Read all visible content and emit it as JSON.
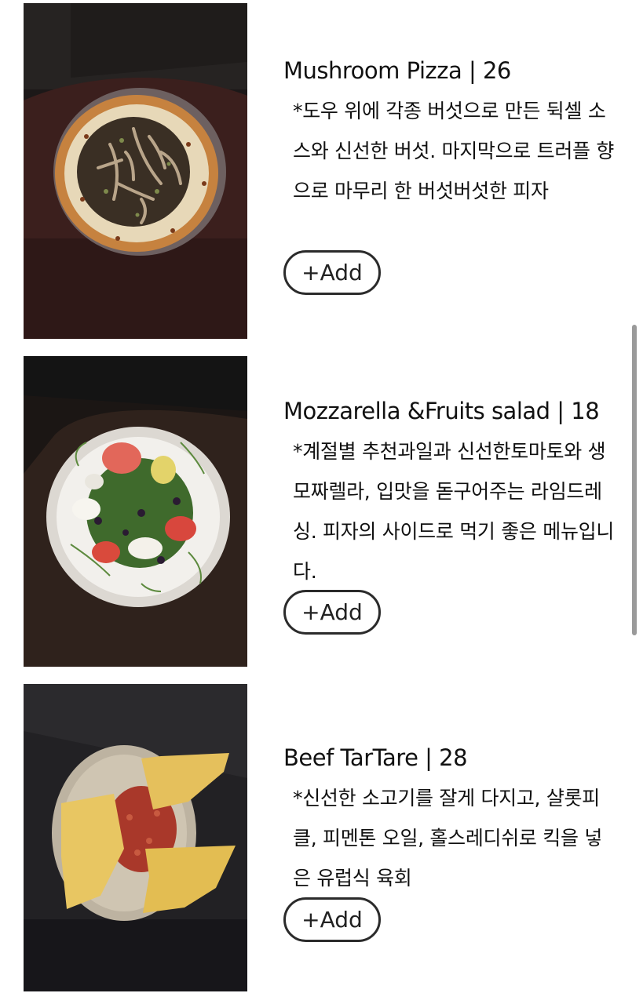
{
  "menu": {
    "items": [
      {
        "title": "Mushroom Pizza | 26",
        "description": "*도우 위에 각종 버섯으로 만든 뒥셀 소스와 신선한 버섯. 마지막으로 트러플 향으로 마무리 한 버섯버섯한 피자",
        "add_label": "+Add"
      },
      {
        "title": "Mozzarella &Fruits salad | 18",
        "description": "*계절별 추천과일과 신선한토마토와 생모짜렐라, 입맛을 돋구어주는 라임드레싱. 피자의 사이드로 먹기 좋은 메뉴입니다.",
        "add_label": "+Add"
      },
      {
        "title": "Beef TarTare | 28",
        "description": "*신선한 소고기를 잘게 다지고, 샬롯피클, 피멘톤 오일, 홀스레디쉬로 킥을 넣은 유럽식 육회",
        "add_label": "+Add"
      }
    ]
  },
  "colors": {
    "background": "#ffffff",
    "text": "#111111",
    "button_border": "#2b2b2b",
    "scrollbar": "#9a9a9a"
  }
}
